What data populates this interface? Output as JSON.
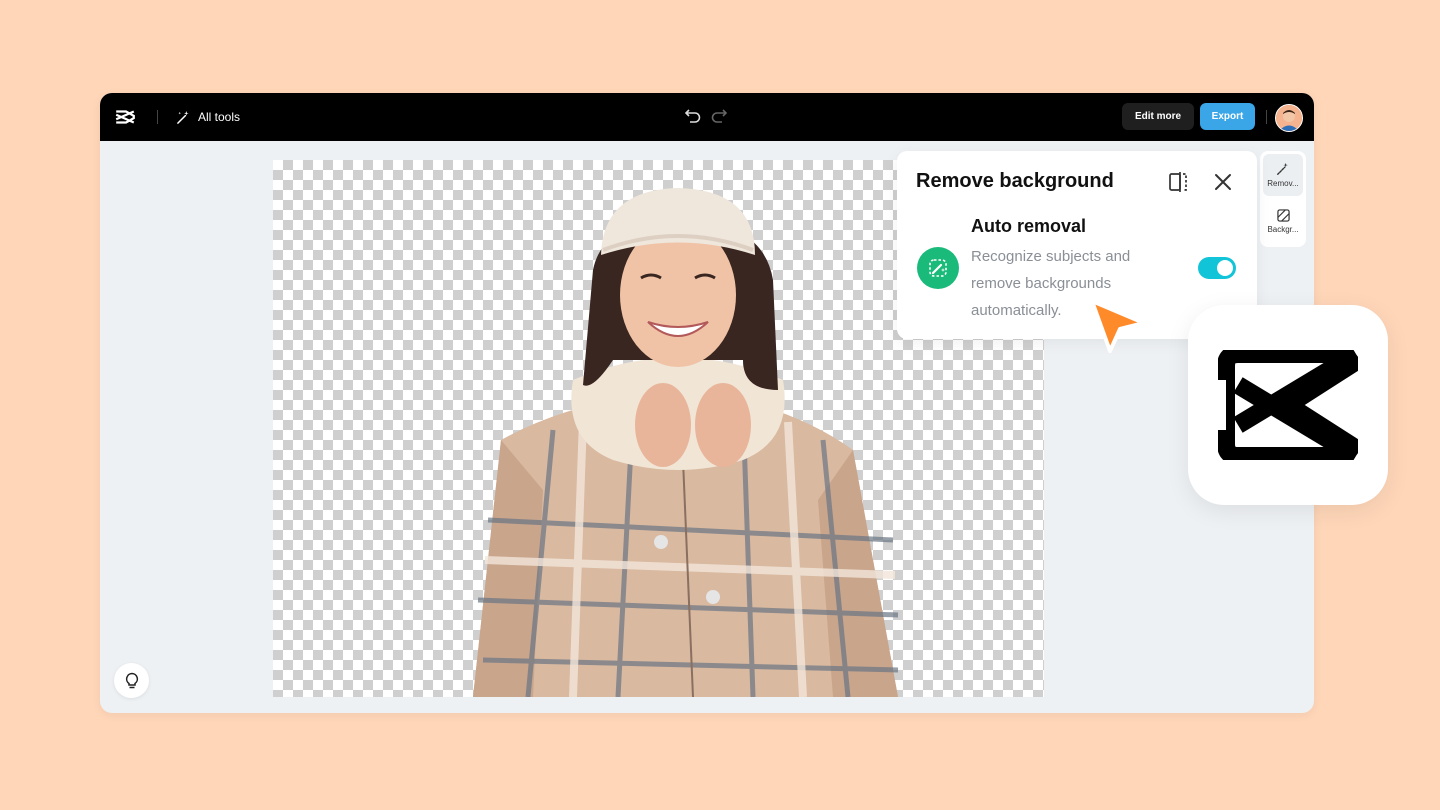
{
  "topbar": {
    "all_tools_label": "All tools",
    "edit_more_label": "Edit more",
    "export_label": "Export"
  },
  "panel": {
    "title": "Remove background",
    "feature_title": "Auto removal",
    "feature_description": "Recognize subjects and remove backgrounds automatically.",
    "toggle_on": true
  },
  "rail": {
    "items": [
      {
        "label": "Remov...",
        "icon": "magic-wand-icon",
        "active": true
      },
      {
        "label": "Backgr...",
        "icon": "background-icon",
        "active": false
      }
    ]
  },
  "colors": {
    "page_background": "#ffd6b8",
    "topbar": "#000000",
    "export_button": "#3aa6e8",
    "toggle_on": "#12c4d8",
    "feature_icon": "#1aba7a",
    "cursor": "#ff8a2a"
  },
  "icons": [
    "capcut-logo-icon",
    "magic-wand-icon",
    "undo-icon",
    "redo-icon",
    "avatar",
    "compare-icon",
    "close-icon",
    "lightbulb-icon",
    "background-icon",
    "pointer-cursor-icon"
  ]
}
